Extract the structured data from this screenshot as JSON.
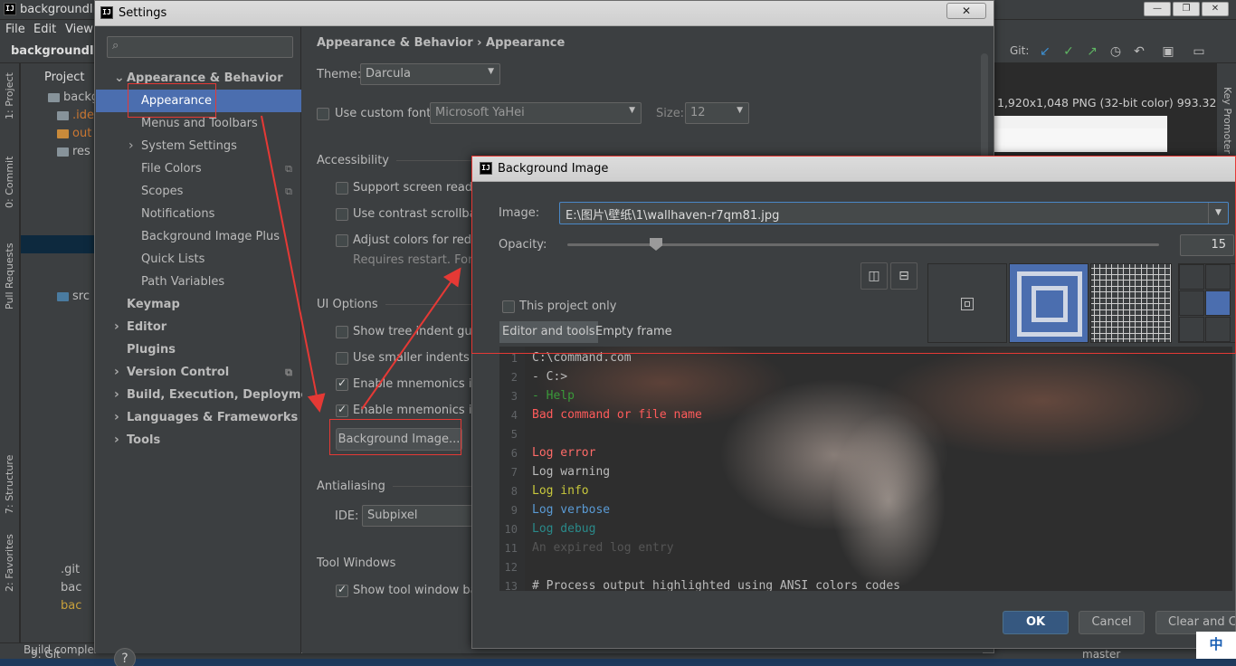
{
  "ide": {
    "title": "backgroundIm",
    "menu": [
      "File",
      "Edit",
      "View"
    ],
    "breadcrumb": "backgroundIm",
    "project_label": "Project",
    "tree": [
      "backg",
      ".ide",
      "out",
      "res",
      "src",
      ".git",
      "bac",
      "bac"
    ],
    "left_tabs": [
      "1: Project",
      "0: Commit",
      "Pull Requests",
      "7: Structure",
      "2: Favorites"
    ],
    "right_tab": "Key Promoter",
    "git_label": "Git:",
    "image_info": "1,920x1,048 PNG (32-bit color) 993.32 kB",
    "status_git": "9: Git",
    "status_text": "Build comple",
    "status_branch": "master",
    "ime": "中"
  },
  "settings": {
    "title": "Settings",
    "search_placeholder": "",
    "nav": [
      {
        "label": "Appearance & Behavior",
        "bold": true,
        "arrow": "down"
      },
      {
        "label": "Appearance",
        "selected": true
      },
      {
        "label": "Menus and Toolbars"
      },
      {
        "label": "System Settings",
        "arrow": "right"
      },
      {
        "label": "File Colors",
        "copy": true
      },
      {
        "label": "Scopes",
        "copy": true
      },
      {
        "label": "Notifications"
      },
      {
        "label": "Background Image Plus"
      },
      {
        "label": "Quick Lists"
      },
      {
        "label": "Path Variables"
      },
      {
        "label": "Keymap",
        "bold": true
      },
      {
        "label": "Editor",
        "bold": true,
        "arrow": "right"
      },
      {
        "label": "Plugins",
        "bold": true
      },
      {
        "label": "Version Control",
        "bold": true,
        "arrow": "right",
        "copy": true
      },
      {
        "label": "Build, Execution, Deployment",
        "bold": true,
        "arrow": "right"
      },
      {
        "label": "Languages & Frameworks",
        "bold": true,
        "arrow": "right"
      },
      {
        "label": "Tools",
        "bold": true,
        "arrow": "right"
      }
    ],
    "breadcrumb": "Appearance & Behavior  ›  Appearance",
    "theme_label": "Theme:",
    "theme_value": "Darcula",
    "custom_font_label": "Use custom font:",
    "font_value": "Microsoft YaHei",
    "size_label": "Size:",
    "size_value": "12",
    "accessibility": "Accessibility",
    "acc_items": [
      {
        "label": "Support screen reader",
        "checked": false
      },
      {
        "label": "Use contrast scrollbar",
        "checked": false
      },
      {
        "label": "Adjust colors for red-g",
        "checked": false
      }
    ],
    "restart_note": "Requires restart. For p",
    "ui_options": "UI Options",
    "ui_items": [
      {
        "label": "Show tree indent guide",
        "checked": false
      },
      {
        "label": "Use smaller indents in",
        "checked": false
      },
      {
        "label": "Enable mnemonics in m",
        "checked": true
      },
      {
        "label": "Enable mnemonics in co",
        "checked": true
      }
    ],
    "bg_image_button": "Background Image...",
    "antialiasing": "Antialiasing",
    "ide_label": "IDE:",
    "ide_value": "Subpixel",
    "tool_windows": "Tool Windows",
    "tool_item": "Show tool window bar"
  },
  "bgdialog": {
    "title": "Background Image",
    "image_label": "Image:",
    "image_path": "E:\\图片\\壁纸\\1\\wallhaven-r7qm81.jpg",
    "opacity_label": "Opacity:",
    "opacity_value": "15",
    "opacity_fraction": 0.15,
    "project_only": "This project only",
    "tab_editor": "Editor and tools",
    "tab_empty": "Empty frame",
    "code": [
      {
        "n": "1",
        "text": "C:\\command.com",
        "color": "#bbbbbb"
      },
      {
        "n": "2",
        "text": "- C:>",
        "color": "#bbbbbb"
      },
      {
        "n": "3",
        "text": "- Help",
        "color": "#3a9a3a"
      },
      {
        "n": "4",
        "text": "Bad command or file name",
        "color": "#ff5b5b"
      },
      {
        "n": "5",
        "text": "",
        "color": "#bbbbbb"
      },
      {
        "n": "6",
        "text": "Log error",
        "color": "#ff6b68"
      },
      {
        "n": "7",
        "text": "Log warning",
        "color": "#bbbbbb"
      },
      {
        "n": "8",
        "text": "Log info",
        "color": "#c8c83c"
      },
      {
        "n": "9",
        "text": "Log verbose",
        "color": "#5a9bd5"
      },
      {
        "n": "10",
        "text": "Log debug",
        "color": "#2a8a8a"
      },
      {
        "n": "11",
        "text": "An expired log entry",
        "color": "#555555"
      },
      {
        "n": "12",
        "text": "",
        "color": "#bbbbbb"
      },
      {
        "n": "13",
        "text": "# Process output highlighted using ANSI colors codes",
        "color": "#bbbbbb"
      }
    ],
    "ok": "OK",
    "cancel": "Cancel",
    "clear": "Clear and Close"
  }
}
